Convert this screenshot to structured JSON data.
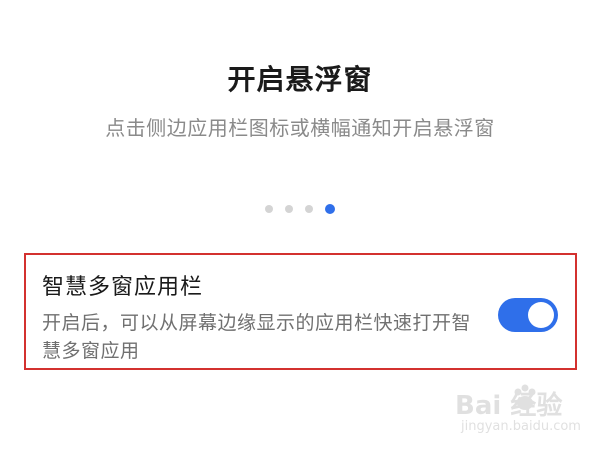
{
  "header": {
    "title": "开启悬浮窗",
    "subtitle": "点击侧边应用栏图标或横幅通知开启悬浮窗"
  },
  "pager": {
    "total": 4,
    "active_index": 3
  },
  "setting": {
    "title": "智慧多窗应用栏",
    "description": "开启后，可以从屏幕边缘显示的应用栏快速打开智慧多窗应用",
    "enabled": true
  },
  "colors": {
    "accent": "#2f6fea",
    "highlight_border": "#d3312f",
    "dot_inactive": "#d4d4d4"
  },
  "watermark": {
    "logo_text": "Bai 经验",
    "url_text": "jingyan.baidu.com"
  },
  "icons": {
    "toggle": "toggle-on-icon",
    "paw": "baidu-paw-icon"
  }
}
